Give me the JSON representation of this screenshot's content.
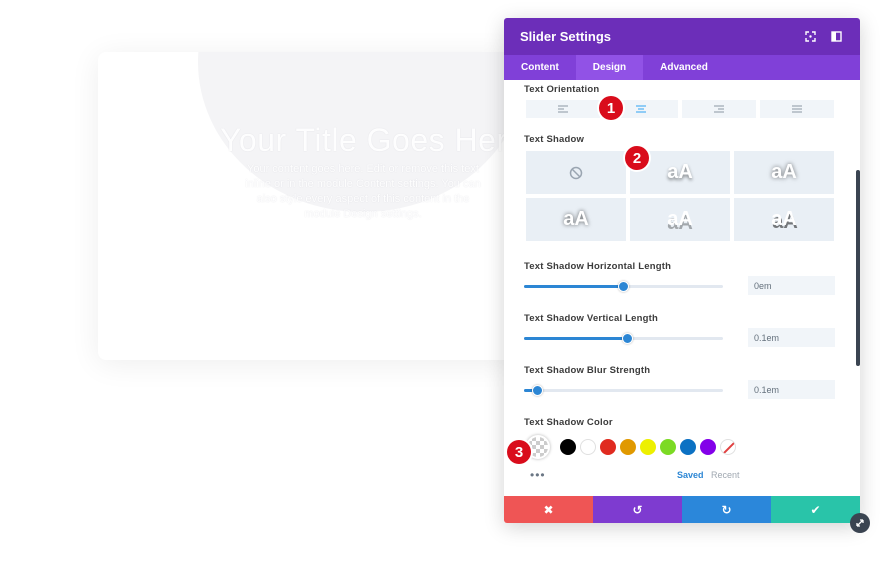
{
  "preview": {
    "title": "Your Title Goes Here",
    "body": "Your content goes here. Edit or remove this text inline or in the module Content settings. You can also style every aspect of this content in the module Design settings."
  },
  "panel": {
    "title": "Slider Settings",
    "header_icons": [
      "expand-icon",
      "sidebar-toggle-icon"
    ],
    "tabs": [
      {
        "label": "Content",
        "active": false
      },
      {
        "label": "Design",
        "active": true
      },
      {
        "label": "Advanced",
        "active": false
      }
    ]
  },
  "text_orientation": {
    "label": "Text Orientation",
    "options": [
      "align-left-icon",
      "align-center-icon",
      "align-right-icon",
      "align-justify-icon"
    ],
    "selected_index": 1
  },
  "text_shadow": {
    "label": "Text Shadow",
    "preset_glyph": "aA",
    "preset_count": 6
  },
  "horizontal_length": {
    "label": "Text Shadow Horizontal Length",
    "value": "0em",
    "slider_fraction": 0.5
  },
  "vertical_length": {
    "label": "Text Shadow Vertical Length",
    "value": "0.1em",
    "slider_fraction": 0.52
  },
  "blur_strength": {
    "label": "Text Shadow Blur Strength",
    "value": "0.1em",
    "slider_fraction": 0.07
  },
  "shadow_color": {
    "label": "Text Shadow Color",
    "swatches": [
      "#000000",
      "#ffffff",
      "#e02b20",
      "#e09900",
      "#edf000",
      "#7cda24",
      "#0c71c3",
      "#8300e9"
    ],
    "more": "•••",
    "saved_label": "Saved",
    "recent_label": "Recent"
  },
  "footer": {
    "cancel": "✖",
    "undo": "↺",
    "redo": "↻",
    "save": "✔"
  },
  "badges": [
    "1",
    "2",
    "3"
  ],
  "colors": {
    "header": "#6c2eb9",
    "tabs": "#8040d8",
    "accent_blue": "#2c86d4",
    "badge_red": "#d90c1b"
  }
}
